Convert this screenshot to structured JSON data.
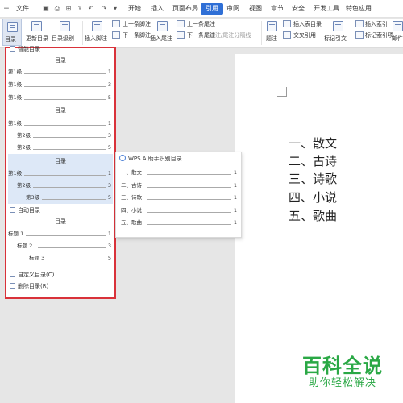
{
  "menubar": {
    "file_label": "文件",
    "undo_icon": "undo-icon",
    "redo_icon": "redo-icon",
    "tabs": [
      {
        "label": "开始"
      },
      {
        "label": "插入"
      },
      {
        "label": "页面布局"
      },
      {
        "label": "引用"
      },
      {
        "label": "审阅"
      },
      {
        "label": "视图"
      },
      {
        "label": "章节"
      },
      {
        "label": "安全"
      },
      {
        "label": "开发工具"
      },
      {
        "label": "特色应用"
      }
    ],
    "active_tab": "引用"
  },
  "ribbon": {
    "toc": "目录",
    "update_toc": "更新目录",
    "toc_level": "目录级别",
    "insert_footnote": "插入脚注",
    "prev_footnote": "上一条脚注",
    "next_footnote": "下一条脚注",
    "insert_endnote": "插入尾注",
    "prev_endnote": "上一条尾注",
    "next_endnote": "下一条尾注",
    "footnote_separator": "脚注/尾注分隔线",
    "caption": "题注",
    "insert_table_of_figures": "插入表目录",
    "cross_reference": "交叉引用",
    "mark_citation": "标记引文",
    "insert_index": "插入索引",
    "mark_index": "标记索引项",
    "mail": "邮件"
  },
  "toc_menu": {
    "smart_toc_label": "智能目录",
    "sections": [
      {
        "title": "目录",
        "rows": [
          {
            "label": "第1级",
            "page": "1"
          },
          {
            "label": "第1级",
            "page": "3"
          },
          {
            "label": "第1级",
            "page": "5"
          }
        ]
      },
      {
        "title": "目录",
        "rows": [
          {
            "label": "第1级",
            "page": "1"
          },
          {
            "label": "第2级",
            "page": "3"
          },
          {
            "label": "第2级",
            "page": "5"
          }
        ]
      },
      {
        "title": "目录",
        "rows": [
          {
            "label": "第1级",
            "page": "1"
          },
          {
            "label": "第2级",
            "page": "3"
          },
          {
            "label": "第3级",
            "page": "5"
          }
        ]
      }
    ],
    "auto_toc_label": "自动目录",
    "auto_section": {
      "title": "目录",
      "rows": [
        {
          "label": "标题 1",
          "page": "1"
        },
        {
          "label": "标题 2",
          "page": "3"
        },
        {
          "label": "标题 3",
          "page": "5"
        }
      ]
    },
    "custom_toc_label": "自定义目录(C)...",
    "delete_toc_label": "删除目录(R)",
    "border_color": "#d9323a",
    "highlight_color": "#dde8f7"
  },
  "submenu": {
    "header": "WPS AI助手识别目录",
    "header_icon": "ai-assistant-icon",
    "rows": [
      {
        "label": "一、散文",
        "page": "1"
      },
      {
        "label": "二、古诗",
        "page": "1"
      },
      {
        "label": "三、诗歌",
        "page": "1"
      },
      {
        "label": "四、小说",
        "page": "1"
      },
      {
        "label": "五、歌曲",
        "page": "1"
      }
    ]
  },
  "document": {
    "headings": [
      "一、散文",
      "二、古诗",
      "三、诗歌",
      "四、小说",
      "五、歌曲"
    ]
  },
  "watermark": {
    "line1": "百科全说",
    "line2": "助你轻松解决",
    "color": "#2aa845"
  }
}
